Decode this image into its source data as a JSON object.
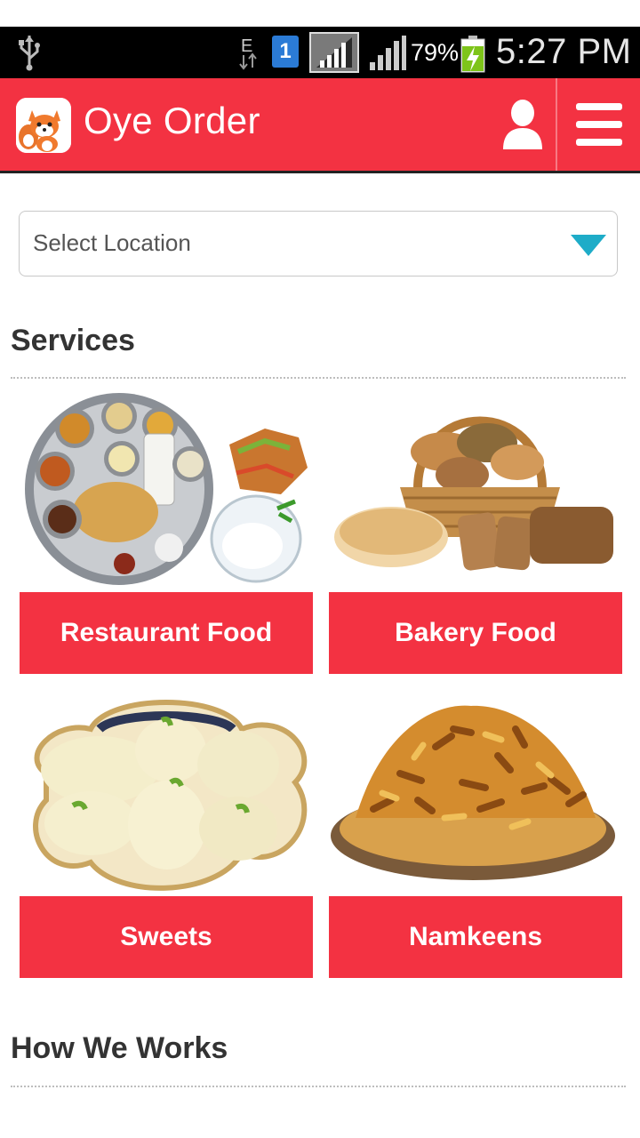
{
  "status_bar": {
    "network_type": "E",
    "sim_number": "1",
    "battery_percent": "79%",
    "time": "5:27 PM"
  },
  "app_bar": {
    "title": "Oye Order",
    "brand_color": "#f33242",
    "icons": [
      "fox-logo-icon",
      "user-icon",
      "hamburger-menu-icon"
    ]
  },
  "location": {
    "placeholder": "Select Location",
    "accent_color": "#1eacc8"
  },
  "services": {
    "title": "Services",
    "items": [
      {
        "label": "Restaurant Food",
        "image": "thali-plate-image"
      },
      {
        "label": "Bakery Food",
        "image": "bread-basket-image"
      },
      {
        "label": "Sweets",
        "image": "rasgulla-sweets-image"
      },
      {
        "label": "Namkeens",
        "image": "namkeen-snacks-image"
      }
    ]
  },
  "how_we_works": {
    "title": "How We Works"
  }
}
